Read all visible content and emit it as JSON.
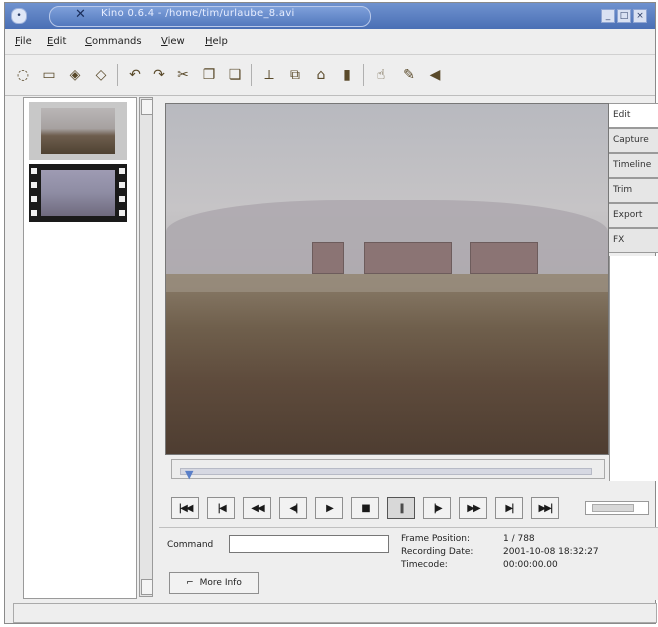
{
  "window": {
    "title": "Kino 0.6.4 - /home/tim/urlaube_8.avi",
    "sys_menu_icon": "circle-menu-icon",
    "app_icon": "x-logo-icon",
    "app_icon_glyph": "✕",
    "window_controls": [
      "minimize-icon",
      "maximize-icon",
      "close-icon"
    ]
  },
  "menu": {
    "items": [
      "File",
      "Edit",
      "Commands",
      "View",
      "Help"
    ]
  },
  "toolbar": {
    "icons": [
      "new-icon",
      "open-icon",
      "save-icon",
      "save-as-icon",
      "undo-icon",
      "redo-icon",
      "cut-icon",
      "copy-icon",
      "paste-icon",
      "paste-before-icon",
      "split-icon",
      "join-icon",
      "preferences-icon",
      "capture-icon",
      "help-icon",
      "exit-icon"
    ]
  },
  "storyboard": {
    "thumbnails": [
      "scene-1",
      "scene-2"
    ]
  },
  "tabs": [
    "Edit",
    "Capture",
    "Timeline",
    "Trim",
    "Export",
    "FX"
  ],
  "transport": {
    "buttons": [
      "|◀◀",
      "|◀",
      "◀◀",
      "◀|",
      "▶",
      "■",
      "||",
      "|▶",
      "▶▶",
      "▶|",
      "▶▶|"
    ]
  },
  "bottom": {
    "command_label": "Command",
    "command_value": "",
    "info_labels": [
      "Frame Position:",
      "Recording Date:",
      "Timecode:"
    ],
    "info_values": [
      "1 / 788",
      "2001-10-08 18:32:27",
      "00:00:00.00"
    ],
    "more_info_label": "More Info"
  },
  "colors": {
    "titlebar": "#4a6fb5",
    "accent": "#5a7fc8"
  }
}
